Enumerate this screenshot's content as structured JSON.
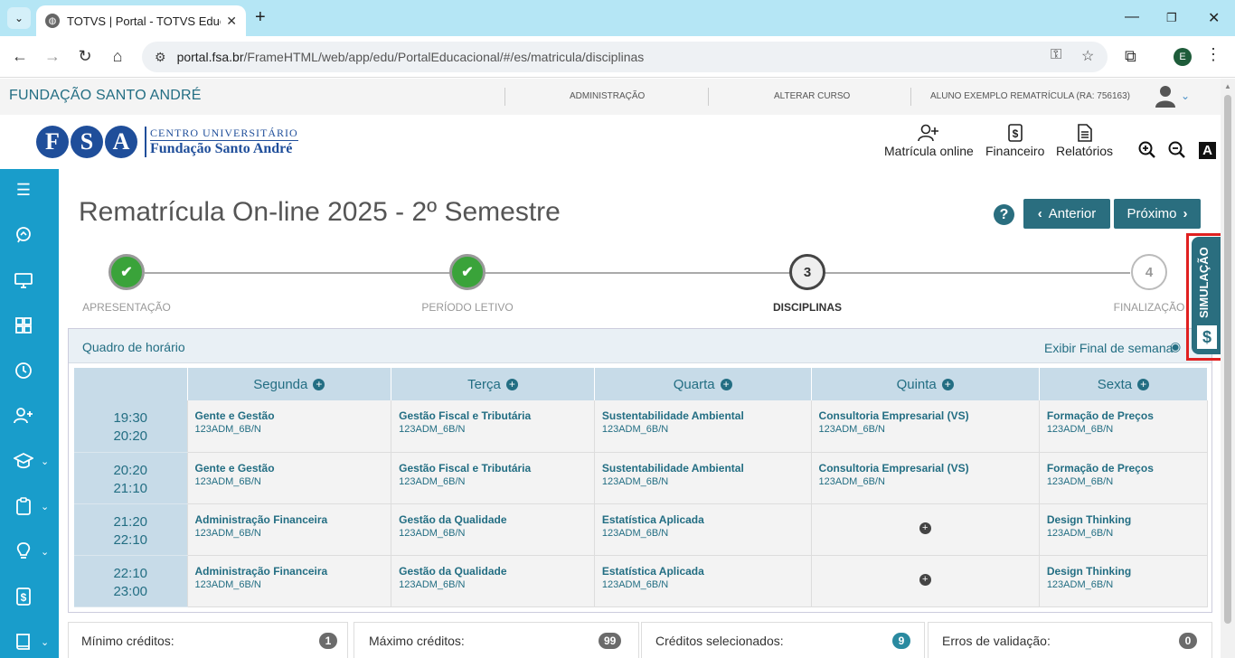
{
  "browser": {
    "tab_title": "TOTVS | Portal - TOTVS Educacional",
    "url_host": "portal.fsa.br",
    "url_path": "/FrameHTML/web/app/edu/PortalEducacional/#/es/matricula/disciplinas",
    "profile_initial": "E"
  },
  "site": {
    "brand": "FUNDAÇÃO SANTO ANDRÉ",
    "admin_link": "ADMINISTRAÇÃO",
    "change_course_link": "ALTERAR CURSO",
    "student": "ALUNO EXEMPLO REMATRÍCULA (RA: 756163)"
  },
  "logo": {
    "letters": [
      "F",
      "S",
      "A"
    ],
    "line1": "CENTRO UNIVERSITÁRIO",
    "line2": "Fundação Santo André"
  },
  "topnav": {
    "matricula": "Matrícula online",
    "financeiro": "Financeiro",
    "relatorios": "Relatórios",
    "font_icon": "A"
  },
  "page": {
    "title": "Rematrícula On-line 2025 - 2º Semestre",
    "help": "?",
    "prev_label": "Anterior",
    "next_label": "Próximo"
  },
  "stepper": {
    "steps": [
      {
        "label": "APRESENTAÇÃO",
        "state": "done",
        "number": ""
      },
      {
        "label": "PERÍODO LETIVO",
        "state": "done",
        "number": ""
      },
      {
        "label": "DISCIPLINAS",
        "state": "current",
        "number": "3"
      },
      {
        "label": "FINALIZAÇÃO",
        "state": "next",
        "number": "4"
      }
    ]
  },
  "simulacao": {
    "label": "SIMULAÇÃO",
    "icon": "$"
  },
  "schedule": {
    "title": "Quadro de horário",
    "weekend_toggle": "Exibir Final de semana",
    "days": [
      "Segunda",
      "Terça",
      "Quarta",
      "Quinta",
      "Sexta"
    ],
    "rows": [
      {
        "start": "19:30",
        "end": "20:20",
        "cells": [
          {
            "subject": "Gente e Gestão",
            "code": "123ADM_6B/N"
          },
          {
            "subject": "Gestão Fiscal e Tributária",
            "code": "123ADM_6B/N"
          },
          {
            "subject": "Sustentabilidade Ambiental",
            "code": "123ADM_6B/N"
          },
          {
            "subject": "Consultoria Empresarial (VS)",
            "code": "123ADM_6B/N"
          },
          {
            "subject": "Formação de Preços",
            "code": "123ADM_6B/N"
          }
        ]
      },
      {
        "start": "20:20",
        "end": "21:10",
        "cells": [
          {
            "subject": "Gente e Gestão",
            "code": "123ADM_6B/N"
          },
          {
            "subject": "Gestão Fiscal e Tributária",
            "code": "123ADM_6B/N"
          },
          {
            "subject": "Sustentabilidade Ambiental",
            "code": "123ADM_6B/N"
          },
          {
            "subject": "Consultoria Empresarial (VS)",
            "code": "123ADM_6B/N"
          },
          {
            "subject": "Formação de Preços",
            "code": "123ADM_6B/N"
          }
        ]
      },
      {
        "start": "21:20",
        "end": "22:10",
        "cells": [
          {
            "subject": "Administração Financeira",
            "code": "123ADM_6B/N"
          },
          {
            "subject": "Gestão da Qualidade",
            "code": "123ADM_6B/N"
          },
          {
            "subject": "Estatística Aplicada",
            "code": "123ADM_6B/N"
          },
          {
            "subject": "",
            "code": ""
          },
          {
            "subject": "Design Thinking",
            "code": "123ADM_6B/N"
          }
        ]
      },
      {
        "start": "22:10",
        "end": "23:00",
        "cells": [
          {
            "subject": "Administração Financeira",
            "code": "123ADM_6B/N"
          },
          {
            "subject": "Gestão da Qualidade",
            "code": "123ADM_6B/N"
          },
          {
            "subject": "Estatística Aplicada",
            "code": "123ADM_6B/N"
          },
          {
            "subject": "",
            "code": ""
          },
          {
            "subject": "Design Thinking",
            "code": "123ADM_6B/N"
          }
        ]
      }
    ]
  },
  "credits": {
    "min_label": "Mínimo créditos:",
    "min_value": "1",
    "max_label": "Máximo créditos:",
    "max_value": "99",
    "selected_label": "Créditos selecionados:",
    "selected_value": "9",
    "errors_label": "Erros de validação:",
    "errors_value": "0"
  },
  "colors": {
    "accent": "#2a6e7f",
    "sidebar": "#199dcb",
    "done": "#3aa33a",
    "highlight": "#e02020"
  }
}
